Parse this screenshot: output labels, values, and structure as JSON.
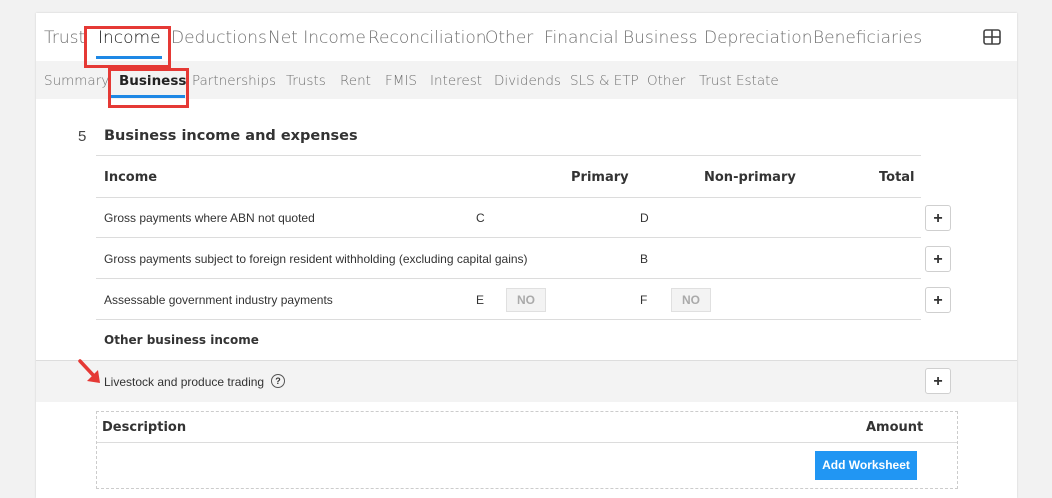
{
  "main_tabs": [
    "Trust",
    "Income",
    "Deductions",
    "Net Income",
    "Reconciliation",
    "Other",
    "Financial",
    "Business",
    "Depreciation",
    "Beneficiaries"
  ],
  "sub_tabs": [
    "Summary",
    "Business",
    "Partnerships",
    "Trusts",
    "Rent",
    "FMIS",
    "Interest",
    "Dividends",
    "SLS & ETP",
    "Other",
    "Trust Estate"
  ],
  "section": {
    "number": "5",
    "title": "Business income and expenses",
    "headers": {
      "income": "Income",
      "primary": "Primary",
      "non_primary": "Non-primary",
      "total": "Total"
    },
    "rows": [
      {
        "label": "Gross payments where ABN not quoted",
        "code_primary": "C",
        "code_non_primary": "D",
        "plus": "+"
      },
      {
        "label": "Gross payments subject to foreign resident withholding (excluding capital gains)",
        "code_primary": "",
        "code_non_primary": "B",
        "plus": "+"
      },
      {
        "label": "Assessable government industry payments",
        "code_primary": "E",
        "primary_value": "NO",
        "code_non_primary": "F",
        "non_primary_value": "NO",
        "plus": "+"
      }
    ],
    "other_business_income": "Other business income",
    "livestock": {
      "label": "Livestock and produce trading",
      "help": "?",
      "plus": "+"
    },
    "worksheet": {
      "description": "Description",
      "amount": "Amount",
      "button": "Add Worksheet"
    }
  },
  "colors": {
    "accent": "#1e88e5",
    "highlight": "#e53935",
    "button": "#2196f3"
  },
  "icons": [
    "layout-grid-icon",
    "help-icon",
    "red-arrow-icon"
  ]
}
